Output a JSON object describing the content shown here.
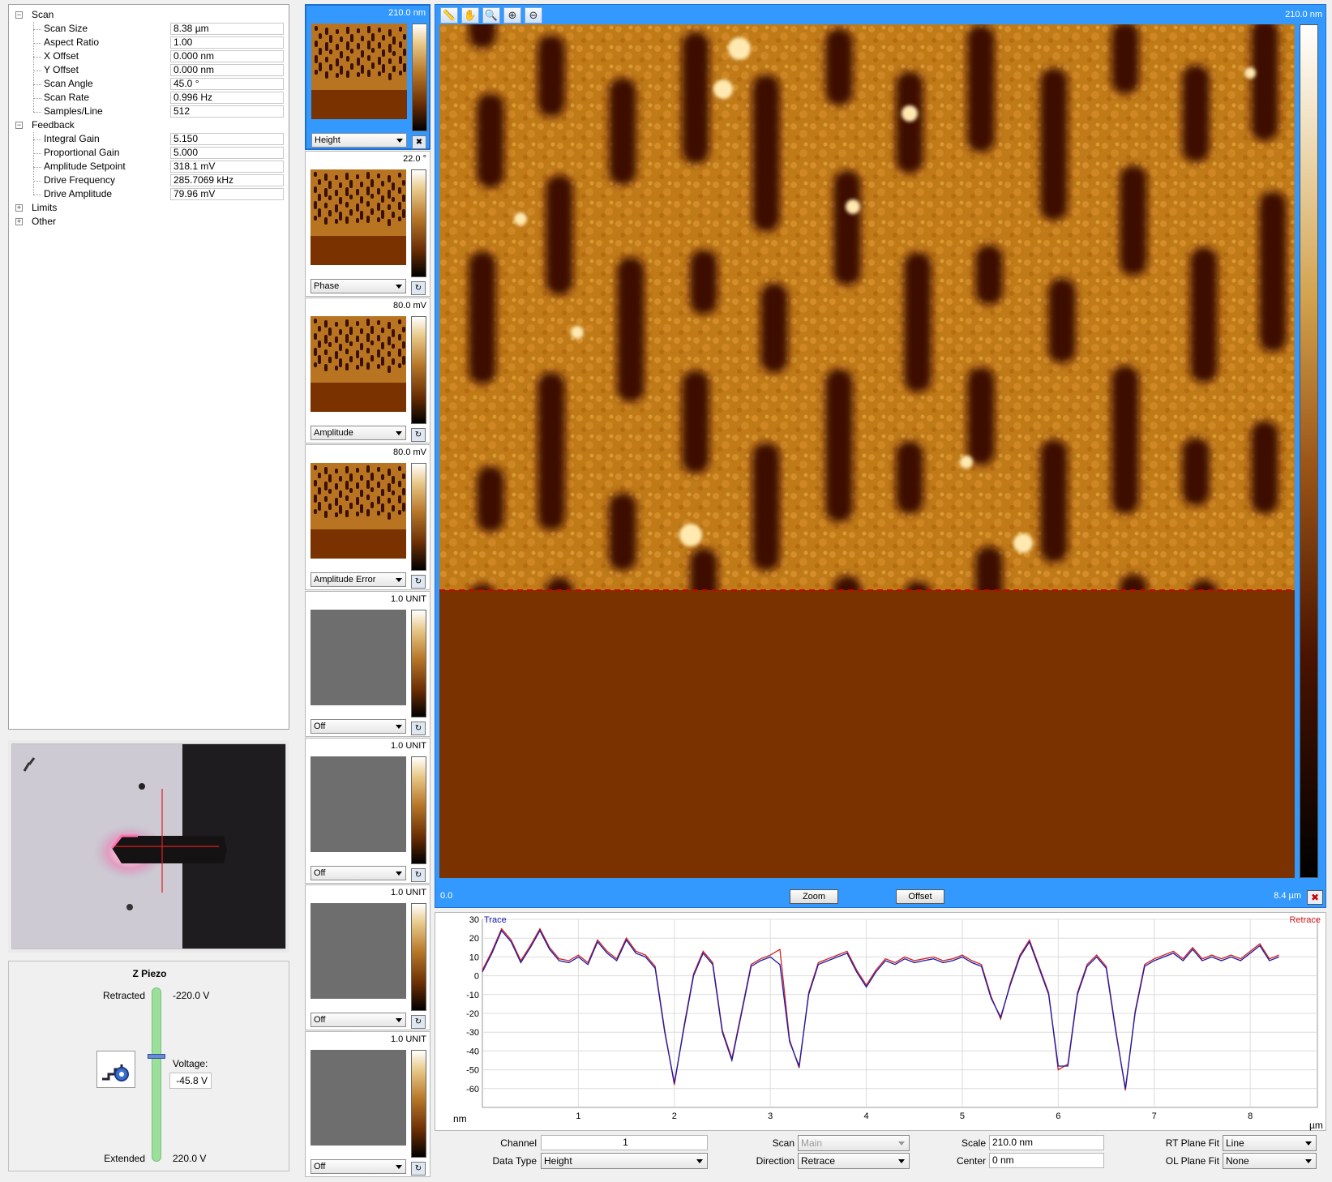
{
  "tree": {
    "scan": {
      "label": "Scan",
      "params": [
        {
          "label": "Scan Size",
          "value": "8.38 µm"
        },
        {
          "label": "Aspect Ratio",
          "value": "1.00"
        },
        {
          "label": "X Offset",
          "value": "0.000 nm"
        },
        {
          "label": "Y Offset",
          "value": "0.000 nm"
        },
        {
          "label": "Scan Angle",
          "value": "45.0 °"
        },
        {
          "label": "Scan Rate",
          "value": "0.996 Hz"
        },
        {
          "label": "Samples/Line",
          "value": "512"
        }
      ]
    },
    "feedback": {
      "label": "Feedback",
      "params": [
        {
          "label": "Integral Gain",
          "value": "5.150"
        },
        {
          "label": "Proportional Gain",
          "value": "5.000"
        },
        {
          "label": "Amplitude Setpoint",
          "value": "318.1 mV"
        },
        {
          "label": "Drive Frequency",
          "value": "285.7069 kHz"
        },
        {
          "label": "Drive Amplitude",
          "value": "79.96 mV"
        }
      ]
    },
    "limits": {
      "label": "Limits"
    },
    "other": {
      "label": "Other"
    }
  },
  "zpiezo": {
    "title": "Z Piezo",
    "retracted_label": "Retracted",
    "retracted_value": "-220.0 V",
    "extended_label": "Extended",
    "extended_value": "220.0 V",
    "voltage_label": "Voltage:",
    "voltage_value": "-45.8 V",
    "level": 0.396
  },
  "thumbnails": [
    {
      "scale": "210.0 nm",
      "channel": "Height",
      "selected": true,
      "has_image": true
    },
    {
      "scale": "22.0 °",
      "channel": "Phase",
      "selected": false,
      "has_image": true
    },
    {
      "scale": "80.0 mV",
      "channel": "Amplitude",
      "selected": false,
      "has_image": true
    },
    {
      "scale": "80.0 mV",
      "channel": "Amplitude Error",
      "selected": false,
      "has_image": true
    },
    {
      "scale": "1.0 UNIT",
      "channel": "Off",
      "selected": false,
      "has_image": false
    },
    {
      "scale": "1.0 UNIT",
      "channel": "Off",
      "selected": false,
      "has_image": false
    },
    {
      "scale": "1.0 UNIT",
      "channel": "Off",
      "selected": false,
      "has_image": false
    },
    {
      "scale": "1.0 UNIT",
      "channel": "Off",
      "selected": false,
      "has_image": false
    }
  ],
  "main_image": {
    "scale_label": "210.0 nm",
    "x_start": "0.0",
    "x_end": "8.4 µm",
    "zoom_label": "Zoom",
    "offset_label": "Offset",
    "scan_progress": 0.663,
    "toolbar_icons": [
      "ruler-icon",
      "pan-hand-icon",
      "zoom-icon",
      "zoom-in-icon",
      "zoom-out-icon"
    ],
    "colors": {
      "frame": "#3399ff",
      "substrate_dark": "#7a3300",
      "scan_line": "#cc0000"
    }
  },
  "chart_data": {
    "type": "line",
    "series": [
      {
        "name": "Trace",
        "color": "#1a1aa8",
        "x": [
          0,
          0.1,
          0.2,
          0.3,
          0.4,
          0.5,
          0.6,
          0.7,
          0.8,
          0.9,
          1.0,
          1.1,
          1.2,
          1.3,
          1.4,
          1.5,
          1.6,
          1.7,
          1.8,
          1.9,
          2.0,
          2.1,
          2.2,
          2.3,
          2.4,
          2.5,
          2.6,
          2.7,
          2.8,
          2.9,
          3.0,
          3.1,
          3.2,
          3.3,
          3.4,
          3.5,
          3.6,
          3.7,
          3.8,
          3.9,
          4.0,
          4.1,
          4.2,
          4.3,
          4.4,
          4.5,
          4.6,
          4.7,
          4.8,
          4.9,
          5.0,
          5.1,
          5.2,
          5.3,
          5.4,
          5.5,
          5.6,
          5.7,
          5.8,
          5.9,
          6.0,
          6.1,
          6.2,
          6.3,
          6.4,
          6.5,
          6.6,
          6.7,
          6.8,
          6.9,
          7.0,
          7.1,
          7.2,
          7.3,
          7.4,
          7.5,
          7.6,
          7.7,
          7.8,
          7.9,
          8.0,
          8.1,
          8.2,
          8.3
        ],
        "y": [
          2,
          12,
          24,
          18,
          7,
          15,
          24,
          14,
          8,
          7,
          10,
          6,
          18,
          12,
          8,
          19,
          12,
          10,
          4,
          -30,
          -57,
          -28,
          0,
          12,
          6,
          -30,
          -45,
          -20,
          5,
          8,
          10,
          6,
          -35,
          -48,
          -10,
          6,
          8,
          10,
          12,
          2,
          -6,
          2,
          8,
          6,
          9,
          7,
          8,
          9,
          7,
          8,
          10,
          7,
          5,
          -12,
          -22,
          -5,
          10,
          18,
          4,
          -10,
          -48,
          -48,
          -10,
          5,
          10,
          4,
          -30,
          -60,
          -20,
          5,
          8,
          10,
          12,
          8,
          14,
          8,
          10,
          8,
          10,
          8,
          12,
          16,
          8,
          10
        ]
      },
      {
        "name": "Retrace",
        "color": "#d02020",
        "x": [
          0,
          0.1,
          0.2,
          0.3,
          0.4,
          0.5,
          0.6,
          0.7,
          0.8,
          0.9,
          1.0,
          1.1,
          1.2,
          1.3,
          1.4,
          1.5,
          1.6,
          1.7,
          1.8,
          1.9,
          2.0,
          2.1,
          2.2,
          2.3,
          2.4,
          2.5,
          2.6,
          2.7,
          2.8,
          2.9,
          3.0,
          3.1,
          3.2,
          3.3,
          3.4,
          3.5,
          3.6,
          3.7,
          3.8,
          3.9,
          4.0,
          4.1,
          4.2,
          4.3,
          4.4,
          4.5,
          4.6,
          4.7,
          4.8,
          4.9,
          5.0,
          5.1,
          5.2,
          5.3,
          5.4,
          5.5,
          5.6,
          5.7,
          5.8,
          5.9,
          6.0,
          6.1,
          6.2,
          6.3,
          6.4,
          6.5,
          6.6,
          6.7,
          6.8,
          6.9,
          7.0,
          7.1,
          7.2,
          7.3,
          7.4,
          7.5,
          7.6,
          7.7,
          7.8,
          7.9,
          8.0,
          8.1,
          8.2,
          8.3
        ],
        "y": [
          3,
          13,
          25,
          19,
          8,
          16,
          25,
          15,
          9,
          8,
          11,
          7,
          19,
          13,
          9,
          20,
          13,
          11,
          5,
          -29,
          -58,
          -27,
          1,
          13,
          7,
          -29,
          -44,
          -19,
          6,
          9,
          11,
          14,
          -34,
          -49,
          -9,
          7,
          9,
          11,
          13,
          3,
          -5,
          3,
          9,
          7,
          10,
          8,
          9,
          10,
          8,
          9,
          11,
          8,
          6,
          -11,
          -23,
          -4,
          11,
          19,
          5,
          -9,
          -50,
          -47,
          -9,
          6,
          11,
          5,
          -29,
          -61,
          -19,
          6,
          9,
          11,
          13,
          9,
          15,
          9,
          11,
          9,
          11,
          9,
          13,
          17,
          9,
          11
        ]
      }
    ],
    "xlabel": "µm",
    "ylabel": "nm",
    "xticks": [
      1,
      2,
      3,
      4,
      5,
      6,
      7,
      8
    ],
    "yticks": [
      30,
      20,
      10,
      0,
      -10,
      -20,
      -30,
      -40,
      -50,
      -60
    ],
    "xlim": [
      0,
      8.7
    ],
    "ylim": [
      -70,
      30
    ],
    "grid": true
  },
  "controls": {
    "channel_label": "Channel",
    "channel_value": "1",
    "data_type_label": "Data Type",
    "data_type_value": "Height",
    "scan_label": "Scan",
    "scan_value": "Main",
    "direction_label": "Direction",
    "direction_value": "Retrace",
    "scale_label": "Scale",
    "scale_value": "210.0 nm",
    "center_label": "Center",
    "center_value": "0 nm",
    "rt_plane_fit_label": "RT Plane Fit",
    "rt_plane_fit_value": "Line",
    "ol_plane_fit_label": "OL Plane Fit",
    "ol_plane_fit_value": "None"
  }
}
